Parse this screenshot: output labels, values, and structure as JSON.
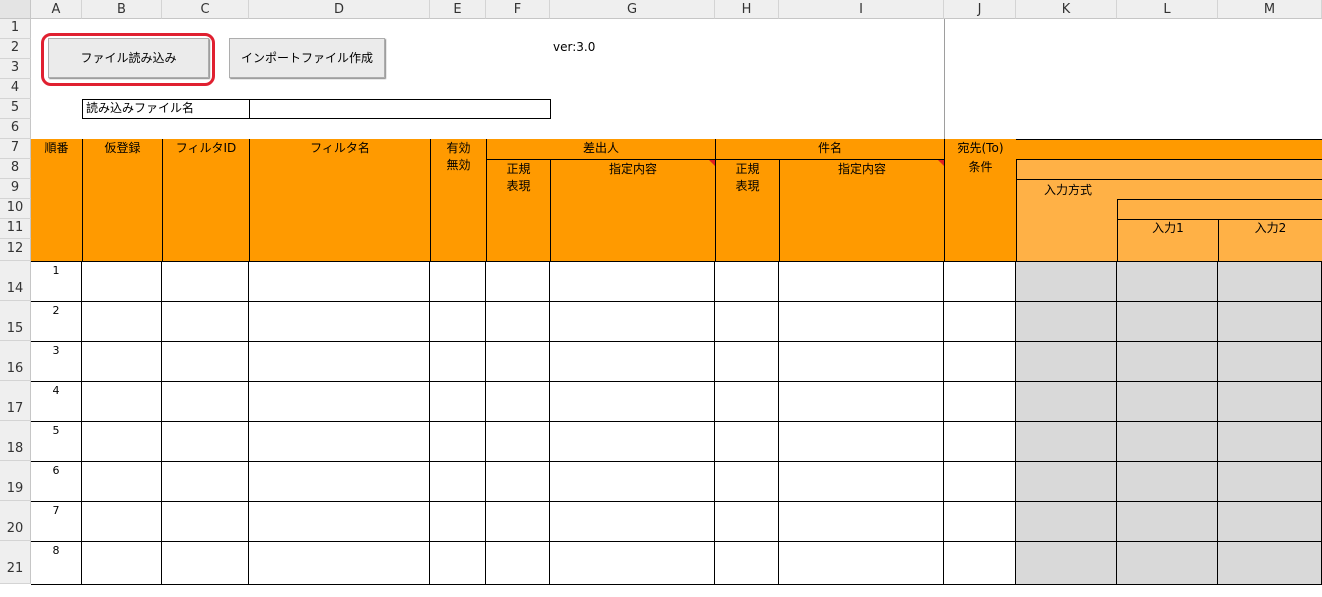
{
  "columns": [
    "A",
    "B",
    "C",
    "D",
    "E",
    "F",
    "G",
    "H",
    "I",
    "J",
    "K",
    "L",
    "M"
  ],
  "rows": [
    "1",
    "2",
    "3",
    "4",
    "5",
    "6",
    "7",
    "8",
    "9",
    "10",
    "11",
    "12",
    "14",
    "15",
    "16",
    "17",
    "18",
    "19",
    "20",
    "21"
  ],
  "buttons": {
    "read_file": "ファイル読み込み",
    "create_import": "インポートファイル作成"
  },
  "version": "ver:3.0",
  "filename_label": "読み込みファイル名",
  "headers": {
    "order": "順番",
    "provisional": "仮登録",
    "filter_id": "フィルタID",
    "filter_name": "フィルタ名",
    "enabled_1": "有効",
    "enabled_2": "無効",
    "sender": "差出人",
    "regex_1": "正規",
    "regex_2": "表現",
    "content": "指定内容",
    "subject": "件名",
    "to_1": "宛先(To)",
    "to_2": "条件",
    "input_method": "入力方式",
    "input1": "入力1",
    "input2": "入力2"
  },
  "record_numbers": [
    "1",
    "2",
    "3",
    "4",
    "5",
    "6",
    "7",
    "8"
  ],
  "colors": {
    "header_orange": "#ff9a00",
    "subheader_orange": "#ffb146",
    "highlight_red": "#e02030",
    "gray_cell": "#d9d9d9"
  }
}
